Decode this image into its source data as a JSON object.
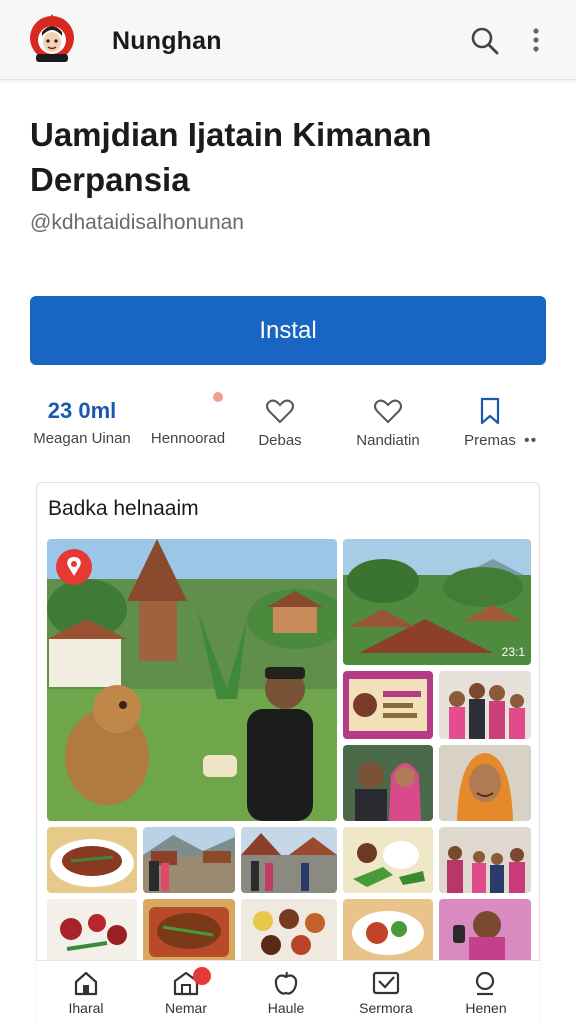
{
  "app_bar": {
    "title": "Nunghan",
    "logo_icon": "mascot-logo-icon",
    "search_icon": "search-icon",
    "more_icon": "more-vert-icon"
  },
  "header": {
    "title": "Uamjdian Ijatain Kimanan Derpansia",
    "handle": "@kdhataidisalhonunan"
  },
  "install_button": {
    "label": "Instal",
    "color": "#1865c3"
  },
  "stats": [
    {
      "value": "23 0ml",
      "label": "Meagan Uinan",
      "icon": null
    },
    {
      "value": "",
      "label": "Hennoorad",
      "icon": null
    },
    {
      "value": "",
      "label": "Debas",
      "icon": "heart-icon"
    },
    {
      "value": "",
      "label": "Nandiatin",
      "icon": "heart-icon"
    },
    {
      "value": "",
      "label": "Premas",
      "icon": "bookmark-icon"
    }
  ],
  "stats_more": "••",
  "gallery": {
    "title": "Badka helnaaim",
    "featured_badge_icon": "location-pin-icon",
    "photo_tag": "23:1"
  },
  "bottom_nav": [
    {
      "label": "Iharal",
      "icon": "home-icon",
      "badge": false
    },
    {
      "label": "Nemar",
      "icon": "store-icon",
      "badge": true
    },
    {
      "label": "Haule",
      "icon": "apple-icon",
      "badge": false
    },
    {
      "label": "Sermora",
      "icon": "inbox-icon",
      "badge": false
    },
    {
      "label": "Henen",
      "icon": "search-icon",
      "badge": false
    }
  ],
  "colors": {
    "accent": "#1865c3",
    "stat_value": "#1a5aae",
    "badge": "#e53935"
  }
}
